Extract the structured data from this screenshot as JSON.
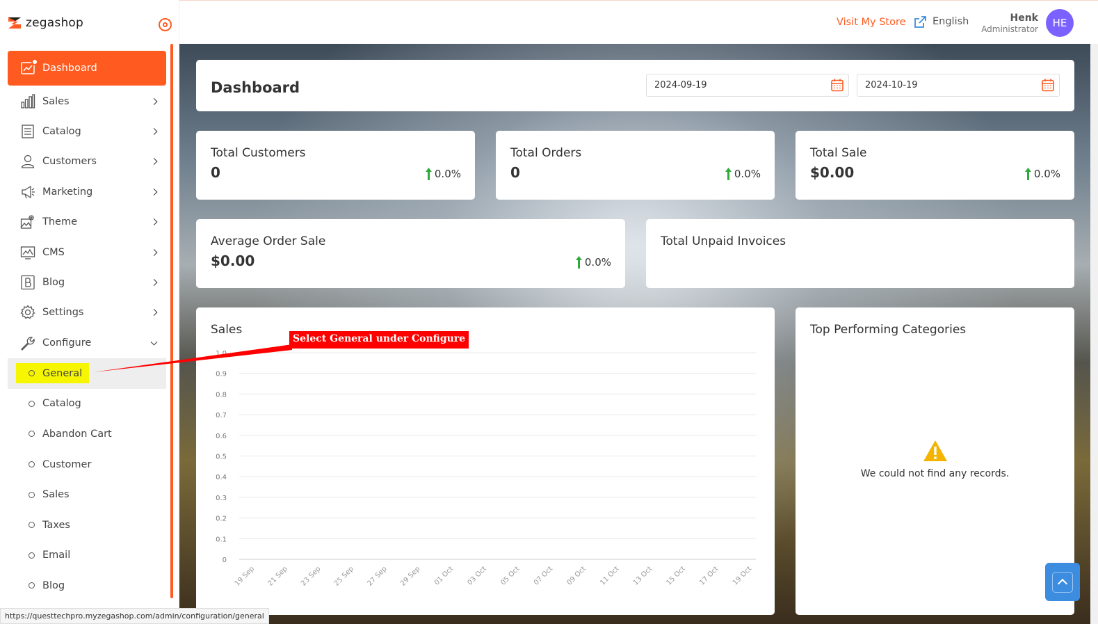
{
  "brand": {
    "name": "zegashop",
    "accent": "#ff5a1f"
  },
  "sidebar": {
    "items": [
      {
        "label": "Dashboard",
        "icon": "dashboard-chart-icon",
        "active": true
      },
      {
        "label": "Sales",
        "icon": "bar-chart-icon"
      },
      {
        "label": "Catalog",
        "icon": "catalog-list-icon"
      },
      {
        "label": "Customers",
        "icon": "person-icon"
      },
      {
        "label": "Marketing",
        "icon": "megaphone-icon"
      },
      {
        "label": "Theme",
        "icon": "theme-image-gear-icon"
      },
      {
        "label": "CMS",
        "icon": "cms-monitor-icon"
      },
      {
        "label": "Blog",
        "icon": "blog-b-icon"
      },
      {
        "label": "Settings",
        "icon": "gear-icon"
      },
      {
        "label": "Configure",
        "icon": "wrench-icon",
        "expanded": true
      }
    ],
    "configure_sub": [
      "General",
      "Catalog",
      "Abandon Cart",
      "Customer",
      "Sales",
      "Taxes",
      "Email",
      "Blog"
    ]
  },
  "topbar": {
    "visit_store": "Visit My Store",
    "language": "English",
    "user_name": "Henk",
    "user_role": "Administrator",
    "avatar_initials": "HE"
  },
  "dashboard": {
    "title": "Dashboard",
    "date_from": "2024-09-19",
    "date_to": "2024-10-19"
  },
  "stats": {
    "total_customers": {
      "label": "Total Customers",
      "value": "0",
      "trend": "0.0%"
    },
    "total_orders": {
      "label": "Total Orders",
      "value": "0",
      "trend": "0.0%"
    },
    "total_sale": {
      "label": "Total Sale",
      "value": "$0.00",
      "trend": "0.0%"
    },
    "average_order_sale": {
      "label": "Average Order Sale",
      "value": "$0.00",
      "trend": "0.0%"
    },
    "total_unpaid_invoices": {
      "label": "Total Unpaid Invoices"
    }
  },
  "chart_data": {
    "type": "line",
    "title": "Sales",
    "x": [
      "19 Sep",
      "21 Sep",
      "23 Sep",
      "25 Sep",
      "27 Sep",
      "29 Sep",
      "01 Oct",
      "03 Oct",
      "05 Oct",
      "07 Oct",
      "09 Oct",
      "11 Oct",
      "13 Oct",
      "15 Oct",
      "17 Oct",
      "19 Oct"
    ],
    "series": [],
    "yticks": [
      "0",
      "0.1",
      "0.2",
      "0.3",
      "0.4",
      "0.5",
      "0.6",
      "0.7",
      "0.8",
      "0.9",
      "1.0"
    ],
    "ylim": [
      0,
      1.0
    ],
    "grid": true
  },
  "top_categories": {
    "title": "Top Performing Categories",
    "empty_message": "We could not find any records."
  },
  "annotation": {
    "text": "Select General under Configure",
    "color": "#ff0000"
  },
  "status_bar": {
    "url": "https://questtechpro.myzegashop.com/admin/configuration/general"
  }
}
